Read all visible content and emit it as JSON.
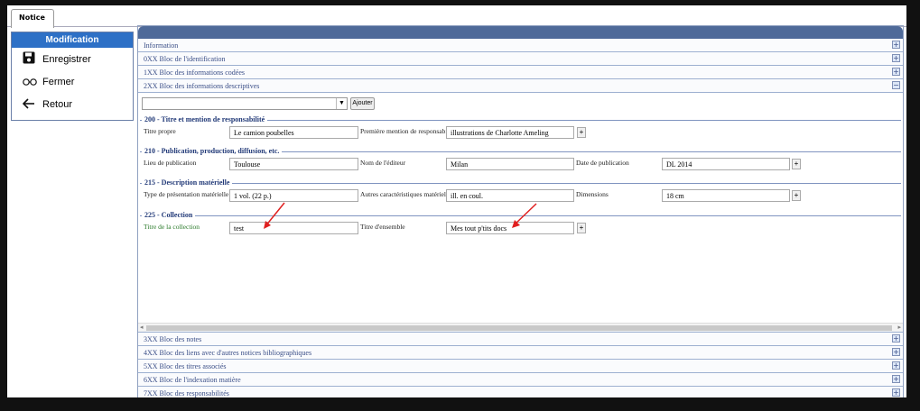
{
  "tab": {
    "label": "Notice"
  },
  "sidebar": {
    "header": "Modification",
    "items": [
      {
        "label": "Enregistrer",
        "icon": "save-icon"
      },
      {
        "label": "Fermer",
        "icon": "glasses-icon"
      },
      {
        "label": "Retour",
        "icon": "back-arrow-icon"
      }
    ]
  },
  "blocs_top": [
    {
      "label": "Information",
      "toggle": "+"
    },
    {
      "label": "0XX Bloc de l'identification",
      "toggle": "+"
    },
    {
      "label": "1XX Bloc des informations codées",
      "toggle": "+"
    },
    {
      "label": "2XX Bloc des informations descriptives",
      "toggle": "−"
    }
  ],
  "toolbar": {
    "select_value": "",
    "add_label": "Ajouter"
  },
  "sections": {
    "s200": {
      "title": "200 - Titre et mention de responsabilité",
      "titre_propre_label": "Titre propre",
      "titre_propre_value": "Le camion poubelles",
      "mention_label": "Première mention de responsabilité",
      "mention_value": "illustrations de Charlotte Ameling",
      "plus": "+"
    },
    "s210": {
      "title": "210 - Publication, production, diffusion, etc.",
      "lieu_label": "Lieu de publication",
      "lieu_value": "Toulouse",
      "editeur_label": "Nom de l'éditeur",
      "editeur_value": "Milan",
      "date_label": "Date de publication",
      "date_value": "DL 2014",
      "plus": "+"
    },
    "s215": {
      "title": "215 - Description matérielle",
      "type_label": "Type de présentation matérielle",
      "type_value": "1 vol. (22 p.)",
      "autres_label": "Autres caractéristiques matérielles",
      "autres_value": "ill. en coul.",
      "dim_label": "Dimensions",
      "dim_value": "18 cm",
      "plus": "+"
    },
    "s225": {
      "title": "225 - Collection",
      "titre_coll_label": "Titre de la collection",
      "titre_coll_value": "test",
      "ensemble_label": "Titre d'ensemble",
      "ensemble_value": "Mes tout p'tits docs",
      "plus": "+"
    }
  },
  "blocs_bottom": [
    {
      "label": "3XX Bloc des notes",
      "toggle": "+"
    },
    {
      "label": "4XX Bloc des liens avec d'autres notices bibliographiques",
      "toggle": "+"
    },
    {
      "label": "5XX Bloc des titres associés",
      "toggle": "+"
    },
    {
      "label": "6XX Bloc de l'indexation matière",
      "toggle": "+"
    },
    {
      "label": "7XX Bloc des responsabilités",
      "toggle": "+"
    }
  ],
  "colors": {
    "header_blue": "#2d70c6",
    "topbar": "#4f6a99",
    "annotation_arrow": "#e02020"
  }
}
